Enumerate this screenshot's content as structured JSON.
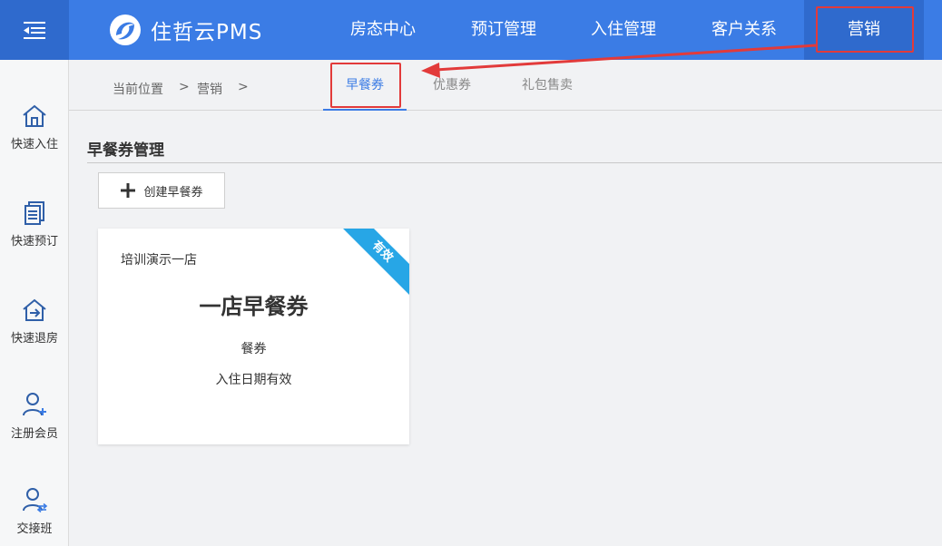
{
  "app": {
    "title": "住哲云PMS"
  },
  "topnav": {
    "items": [
      {
        "label": "房态中心"
      },
      {
        "label": "预订管理"
      },
      {
        "label": "入住管理"
      },
      {
        "label": "客户关系"
      },
      {
        "label": "营销"
      }
    ],
    "active": "营销"
  },
  "sidebar": {
    "items": [
      {
        "label": "快速入住",
        "icon": "home-icon"
      },
      {
        "label": "快速预订",
        "icon": "document-icon"
      },
      {
        "label": "快速退房",
        "icon": "checkout-icon"
      },
      {
        "label": "注册会员",
        "icon": "add-user-icon"
      },
      {
        "label": "交接班",
        "icon": "shift-user-icon"
      }
    ]
  },
  "breadcrumb": {
    "prefix": "当前位置",
    "sep": ">",
    "current": "营销",
    "trail": ">"
  },
  "subtabs": [
    {
      "label": "早餐券"
    },
    {
      "label": "优惠券"
    },
    {
      "label": "礼包售卖"
    }
  ],
  "section": {
    "title": "早餐券管理"
  },
  "create_button": {
    "label": "创建早餐券"
  },
  "card": {
    "hotel": "培训演示一店",
    "name": "一店早餐券",
    "type": "餐券",
    "validity": "入住日期有效",
    "badge": "有效"
  },
  "colors": {
    "primary": "#3b7ce5",
    "primary_dark": "#2f6acd",
    "highlight": "#e23a3a",
    "badge": "#27a6e6"
  }
}
